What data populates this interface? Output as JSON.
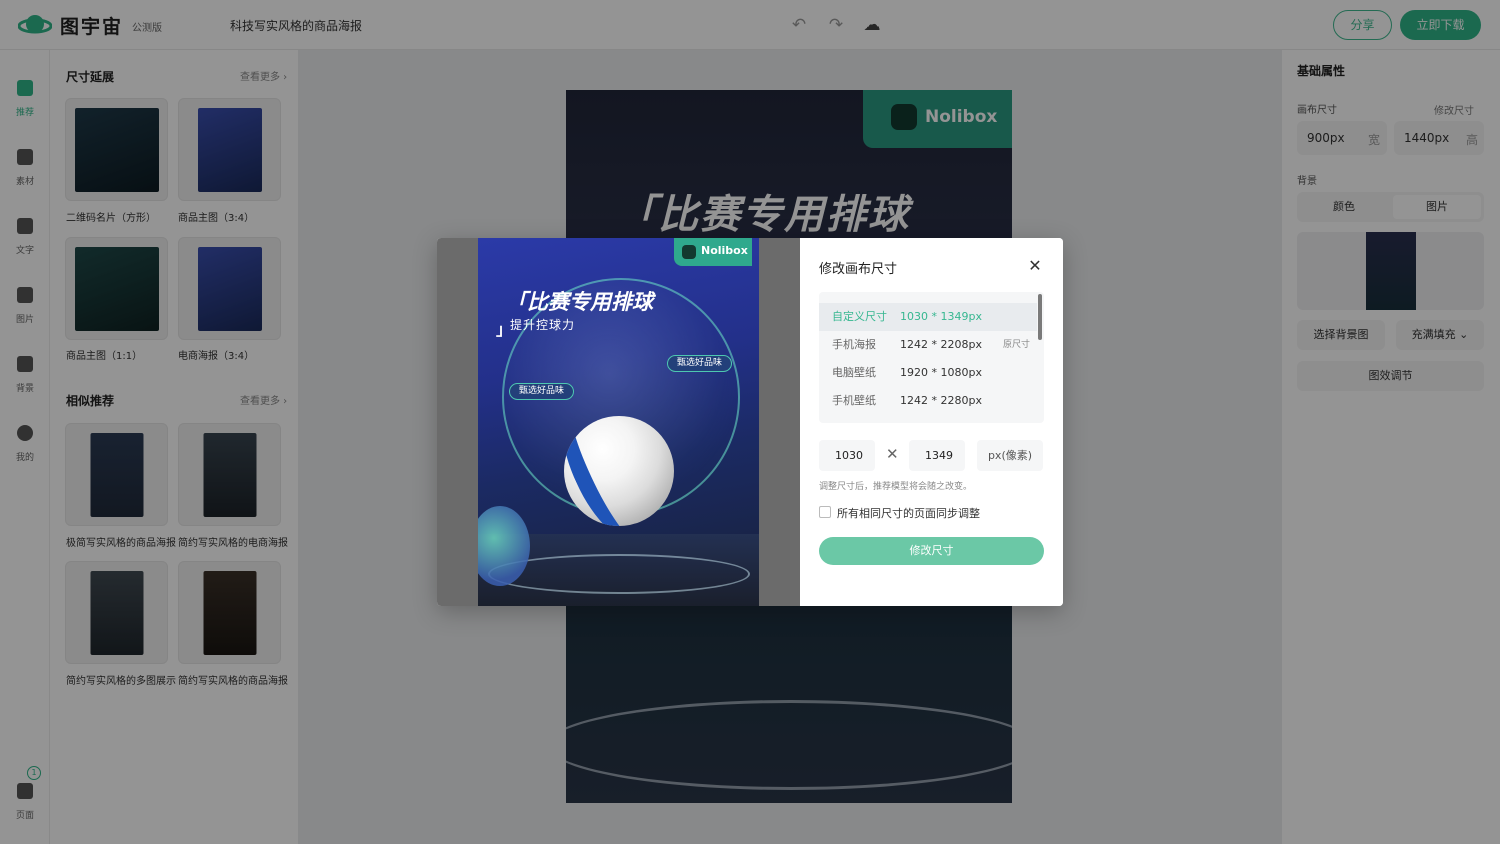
{
  "app": {
    "brand": "图宇宙",
    "beta": "公测版",
    "doc_title": "科技写实风格的商品海报"
  },
  "topbar": {
    "undo_icon": "undo-icon",
    "redo_icon": "redo-icon",
    "cloud_icon": "cloud-save-icon",
    "share_label": "分享",
    "download_label": "立即下载"
  },
  "leftnav": {
    "items": [
      {
        "label": "推荐",
        "icon": "recommend-icon"
      },
      {
        "label": "素材",
        "icon": "material-icon"
      },
      {
        "label": "文字",
        "icon": "text-icon"
      },
      {
        "label": "图片",
        "icon": "image-icon"
      },
      {
        "label": "背景",
        "icon": "background-icon"
      },
      {
        "label": "我的",
        "icon": "user-icon"
      }
    ],
    "pages_label": "页面",
    "pages_count": "1"
  },
  "lpanel": {
    "section1": {
      "title": "尺寸延展",
      "more": "查看更多 ›"
    },
    "section1_items": [
      "二维码名片（方形）",
      "商品主图（3:4）",
      "商品主图（1:1）",
      "电商海报（3:4）"
    ],
    "section2": {
      "title": "相似推荐",
      "more": "查看更多 ›"
    },
    "section2_items": [
      "极简写实风格的商品海报",
      "简约写实风格的电商海报",
      "简约写实风格的多图展示",
      "简约写实风格的商品海报"
    ]
  },
  "canvas": {
    "poster_title": "「比赛专用排球",
    "logo_text": "Nolibox"
  },
  "rpanel": {
    "title": "基础属性",
    "canvas_size_label": "画布尺寸",
    "modify_size_label": "修改尺寸",
    "width_value": "900px",
    "width_suffix": "宽",
    "height_value": "1440px",
    "height_suffix": "高",
    "background_label": "背景",
    "tab_color": "颜色",
    "tab_image": "图片",
    "choose_bg": "选择背景图",
    "fill_mode": "充满填充 ⌄",
    "image_adjust": "图效调节"
  },
  "modal": {
    "title": "修改画布尺寸",
    "close_icon": "close-icon",
    "sizes": [
      {
        "name": "自定义尺寸",
        "dim": "1030 * 1349px",
        "tag": ""
      },
      {
        "name": "手机海报",
        "dim": "1242 * 2208px",
        "tag": "原尺寸"
      },
      {
        "name": "电脑壁纸",
        "dim": "1920 * 1080px",
        "tag": ""
      },
      {
        "name": "手机壁纸",
        "dim": "1242 * 2280px",
        "tag": ""
      }
    ],
    "width_value": "1030",
    "height_value": "1349",
    "unit": "px(像素)",
    "hint": "调整尺寸后，推荐模型将会随之改变。",
    "sync_label": "所有相同尺寸的页面同步调整",
    "submit": "修改尺寸",
    "preview": {
      "logo": "Nolibox",
      "title": "「比赛专用排球",
      "quote_close": "」",
      "subtitle": "提升控球力",
      "badge1": "甄选好品味",
      "badge2": "甄选好品味"
    }
  }
}
